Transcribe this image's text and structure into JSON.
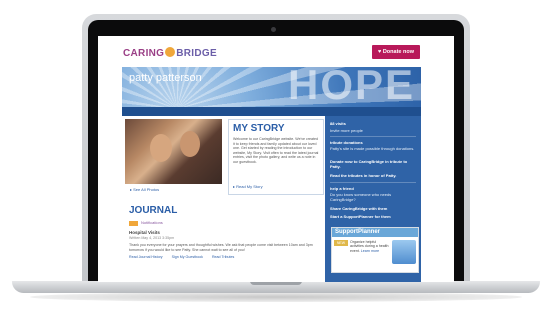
{
  "brand": {
    "caring": "CARING",
    "bridge": "BRIDGE",
    "colors": {
      "purple": "#9a3f86",
      "blue": "#2b5ea7",
      "donate": "#b8195a"
    }
  },
  "header": {
    "donate_label": "Donate now",
    "page_title": "patty patterson",
    "hero_word": "HOPE"
  },
  "nav": {
    "items": [
      "WELCOME",
      "My Story",
      "Journal",
      "Guestbook",
      "Photos",
      "Tributes",
      "Resources"
    ]
  },
  "story": {
    "photo_link": "See All Photos",
    "title": "MY STORY",
    "text": "Welcome to our CaringBridge website. We've created it to keep friends and family updated about our loved one. Get started by reading the introduction to our website, My Story. Visit often to read the latest journal entries, visit the photo gallery, and write us a note in our guestbook.",
    "more_link": "Read My Story"
  },
  "journal": {
    "title": "JOURNAL",
    "badge_label": "Notifications",
    "entry_title": "Hospital Visits",
    "entry_date": "Written May 4, 2013 3:35pm",
    "entry_text": "Thank you everyone for your prayers and thoughtful wishes. We ask that people come visit between 10am and 3pm tomorrow if you would like to see Patty. She cannot wait to see all of you!",
    "links": [
      "Read Journal History",
      "Sign My Guestbook",
      "Read Tributes"
    ]
  },
  "sidebar": {
    "visits": "88 visits",
    "invite": "Invite more people",
    "tribute_heading": "tribute donations",
    "tribute_text": "Patty's site is made possible through donations.",
    "donate_link": "Donate now to CaringBridge in tribute to Patty.",
    "tributes_link": "Read the tributes in honor of Patty.",
    "help_heading": "help a friend",
    "help_text": "Do you know someone who needs CaringBridge?",
    "share_link": "Share CaringBridge with them",
    "planner_link": "Start a SupportPlanner for them"
  },
  "support_planner": {
    "title": "SupportPlanner",
    "badge": "NEW",
    "text": "Organize helpful activities during a health event.",
    "learn": "Learn more"
  }
}
